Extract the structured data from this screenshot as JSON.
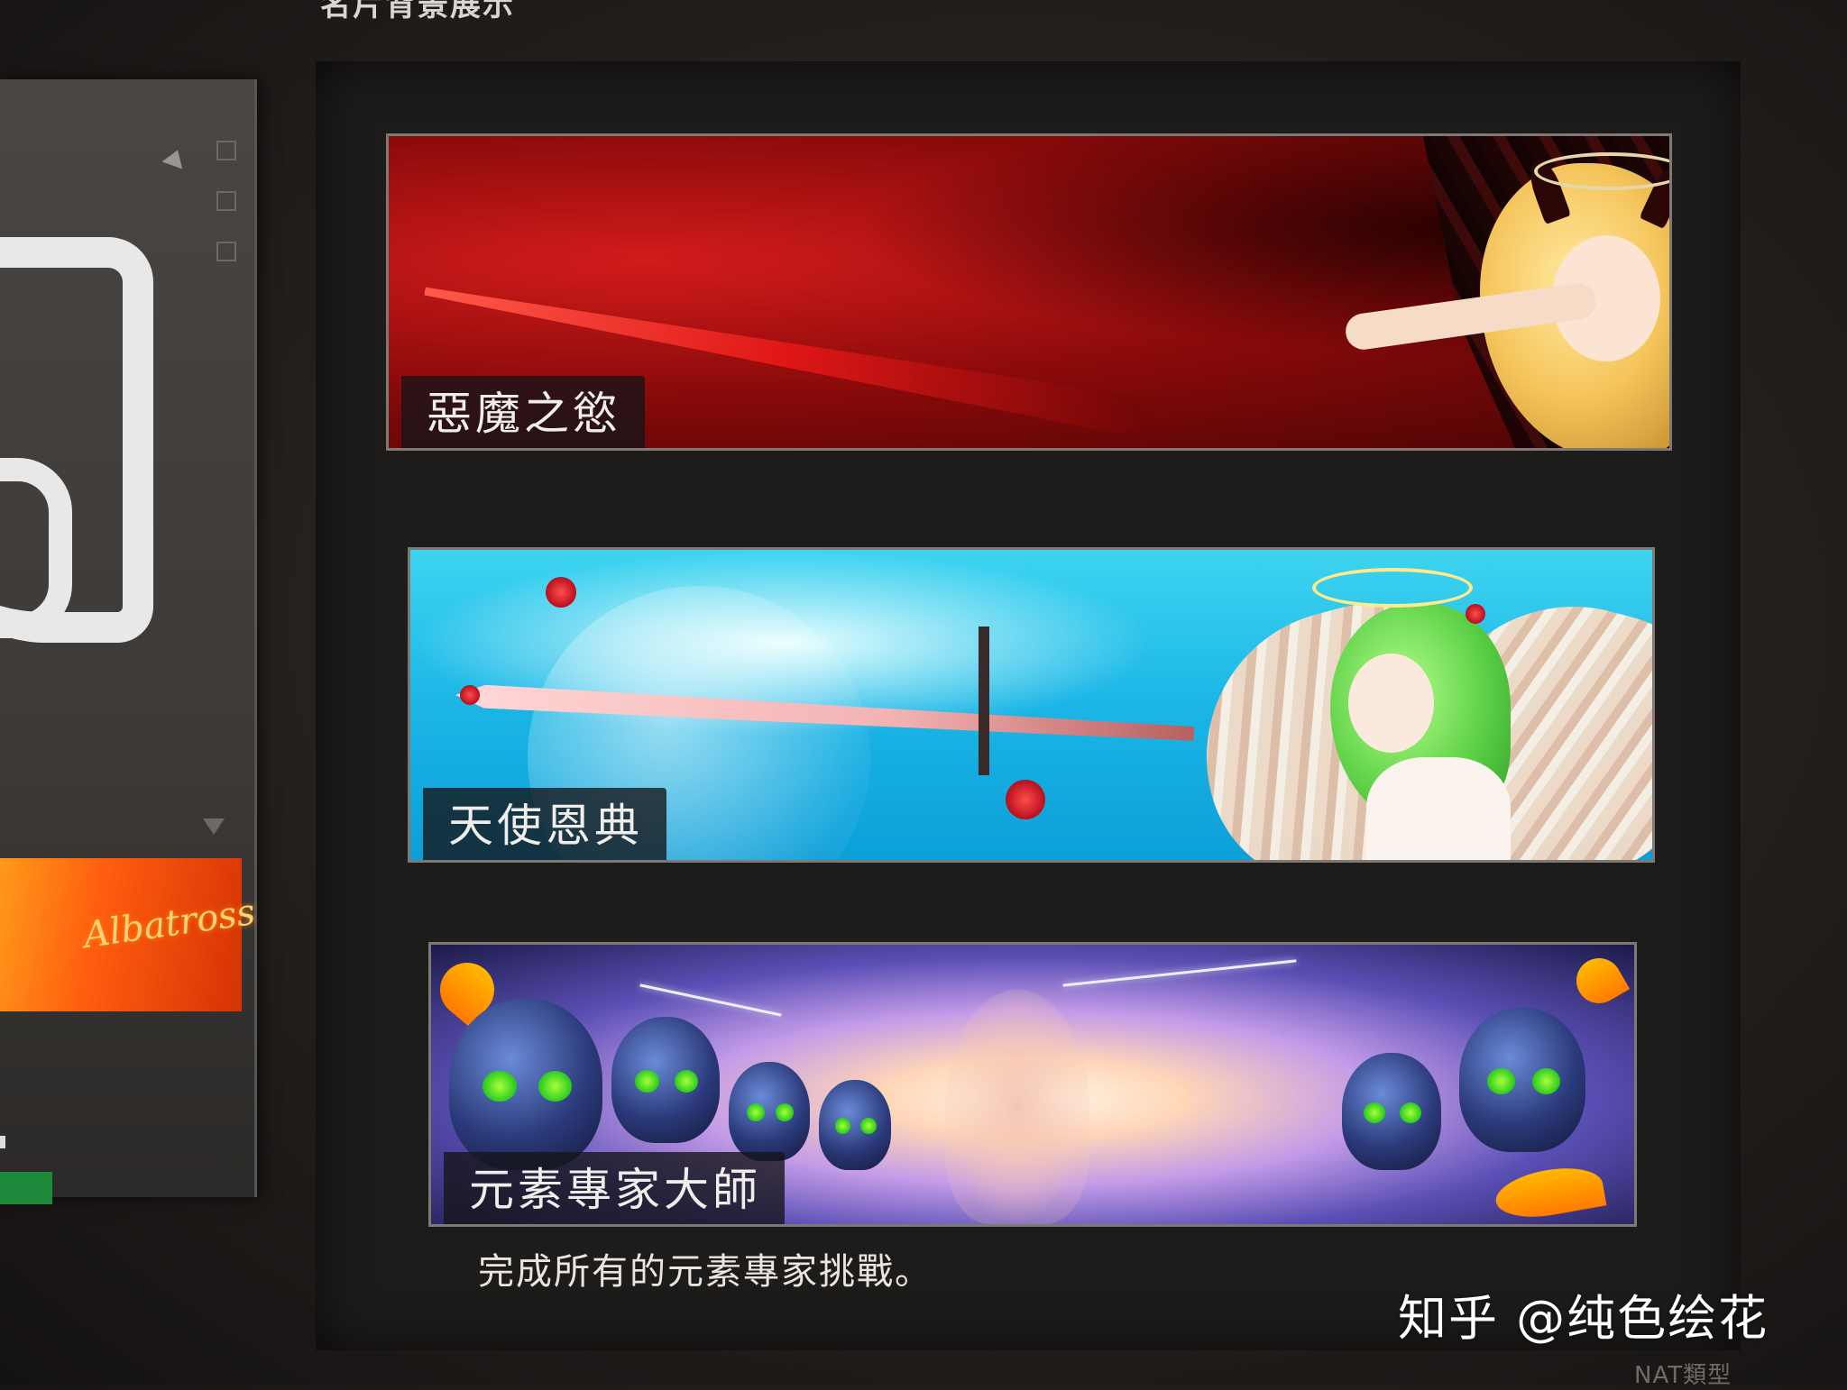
{
  "header": {
    "title": "名片背景展示"
  },
  "side_panel": {
    "thumbnail_text": "Albatross"
  },
  "banners": [
    {
      "label": "惡魔之慾"
    },
    {
      "label": "天使恩典"
    },
    {
      "label": "元素專家大師"
    }
  ],
  "selected_banner": {
    "description": "完成所有的元素專家挑戰。"
  },
  "watermark": "知乎 @纯色绘花",
  "corner_label": "NAT類型",
  "colors": {
    "panel_bg": "#1e1c1b",
    "label_bg": "#141418",
    "demon_accent": "#d31b1b",
    "angel_accent": "#1bb6e6",
    "element_accent": "#5a4fb5"
  }
}
